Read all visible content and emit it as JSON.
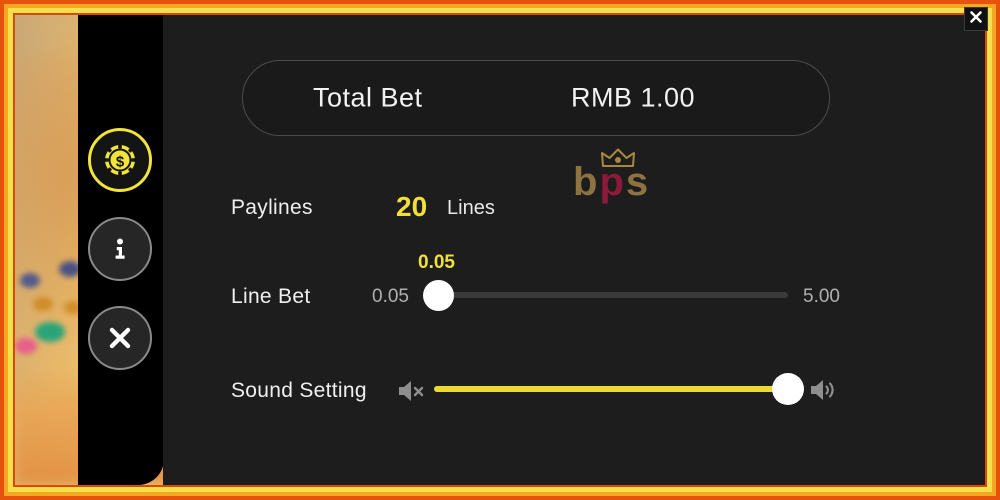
{
  "window": {
    "close_icon": "close-icon"
  },
  "sidebar": {
    "items": [
      {
        "id": "bet-settings",
        "icon": "casino-chip-icon",
        "active": true
      },
      {
        "id": "info",
        "icon": "info-icon",
        "active": false
      },
      {
        "id": "close",
        "icon": "close-icon",
        "active": false
      }
    ]
  },
  "panel": {
    "total_bet": {
      "label": "Total Bet",
      "value": "RMB 1.00"
    },
    "paylines": {
      "label": "Paylines",
      "count": "20",
      "unit": "Lines"
    },
    "line_bet": {
      "label": "Line Bet",
      "current": "0.05",
      "min": "0.05",
      "max": "5.00"
    },
    "sound": {
      "label": "Sound Setting",
      "mute_icon": "volume-mute-icon",
      "up_icon": "volume-up-icon",
      "level_percent": "100"
    },
    "watermark": {
      "part1": "b",
      "part2": "p",
      "part3": "s",
      "crown_icon": "crown-icon"
    }
  },
  "colors": {
    "accent_yellow": "#f2e03a",
    "slider_yellow": "#ebd833",
    "panel_bg": "#1d1d1d",
    "sidebar_bg": "#000000",
    "text_primary": "#f2f2f2",
    "text_muted": "#b0b0b0",
    "frame_orange": "#e8520f",
    "frame_yellow": "#f3e04a",
    "watermark_gold": "#8d7340",
    "watermark_crimson": "#8d1a3a"
  }
}
